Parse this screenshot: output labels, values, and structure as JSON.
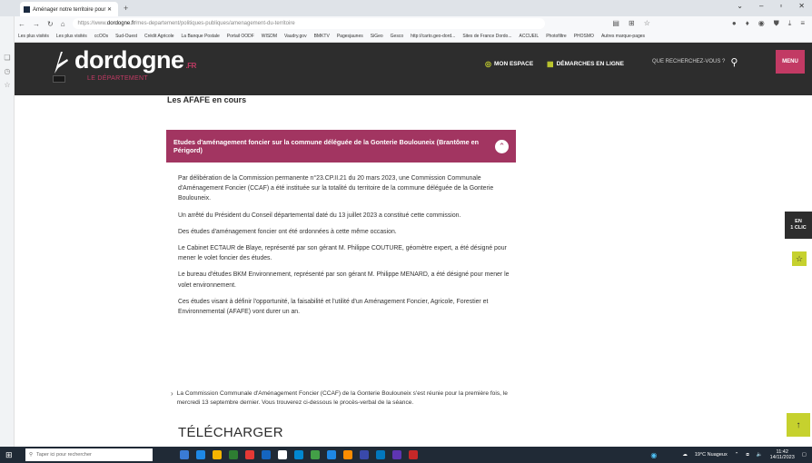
{
  "browser": {
    "tab_title": "Aménager notre territoire pour ✕",
    "url_prefix": "https://www.",
    "url_domain": "dordogne.fr",
    "url_path": "/mes-departement/politiques-publiques/amenagement-du-territoire",
    "bookmarks": [
      "Les plus visités",
      "Les plus visités",
      "ccOOs",
      "Sud-Ouest",
      "Crédit Agricole",
      "La Banque Postale",
      "Portail OODF",
      "WISDM",
      "Vaudry.gov",
      "BMKTV",
      "Pagesjaunes",
      "SiGeo",
      "Gesco",
      "http://carto.geo-dord...",
      "Sites de France Dordo...",
      "ACCUEIL",
      "Photofiltre",
      "PHOSMO",
      "Autres marque-pages"
    ]
  },
  "header": {
    "logo_text": "dordogne",
    "logo_suffix": ".FR",
    "logo_sub": "LE DÉPARTEMENT",
    "mon_espace": "MON ESPACE",
    "demarches": "DÉMARCHES EN LIGNE",
    "search_placeholder": "QUE RECHERCHEZ-VOUS ?",
    "menu_label": "MENU"
  },
  "main": {
    "section_title": "Les AFAFE en cours",
    "accordion_title": "Etudes d'aménagement foncier sur la commune déléguée de la Gonterie Boulouneix (Brantôme en Périgord)",
    "paragraphs": [
      "Par délibération de la Commission permanente n°23.CP.II.21 du 20 mars 2023, une Commission Communale d'Aménagement Foncier (CCAF) a été instituée sur la totalité du territoire de la commune déléguée de la Gonterie Boulouneix.",
      "Un arrêté du Président du Conseil départemental daté du 13 juillet 2023 a constitué cette commission.",
      "Des études d'aménagement foncier ont été ordonnées à cette même occasion.",
      "Le Cabinet ECTAUR de Blaye, représenté par son gérant M. Philippe COUTURE, géomètre expert, a été désigné pour mener le volet foncier des études.",
      "Le bureau d'études BKM Environnement, représenté par son gérant M. Philippe MENARD, a été désigné pour mener le volet environnement.",
      "Ces études visant à définir l'opportunité, la faisabilité et l'utilité d'un Aménagement Foncier, Agricole, Forestier et Environnemental (AFAFE) vont durer un an."
    ],
    "bullet_text": "La Commission Communale d'Aménagement Foncier (CCAF) de la Gonterie Boulouneix s'est réunie pour la première fois, le mercredi 13 septembre dernier. Vous trouverez ci-dessous le procès-verbal de la séance.",
    "download_heading": "TÉLÉCHARGER",
    "en_clic_line1": "EN",
    "en_clic_line2": "1 CLIC"
  },
  "taskbar": {
    "search_placeholder": "Taper ici pour rechercher",
    "weather": "19°C Nuageux",
    "time": "11:42",
    "date": "14/11/2023"
  },
  "colors": {
    "brand_magenta": "#a23561",
    "header_dark": "#2d2d2d",
    "accent_lime": "#c6d12e"
  }
}
